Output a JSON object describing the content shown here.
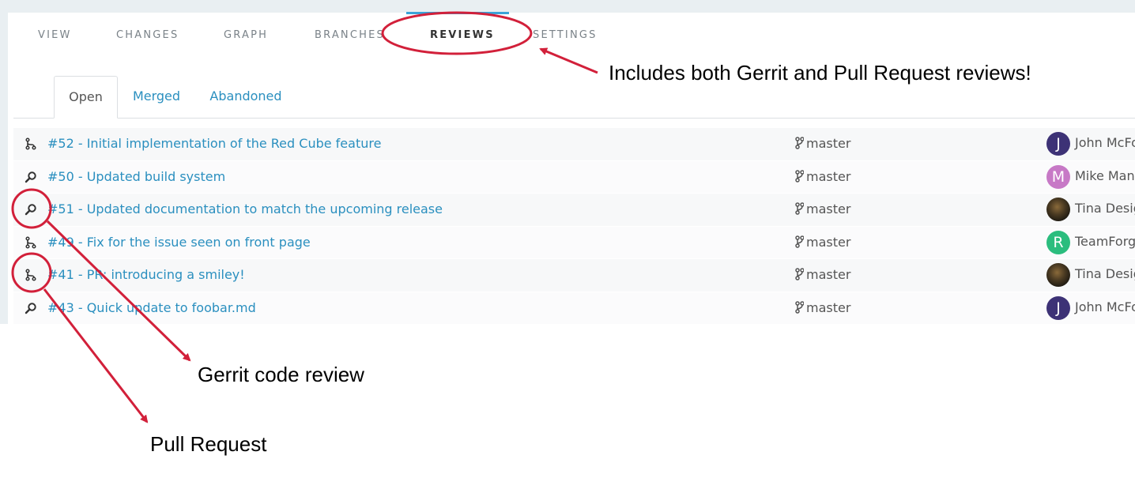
{
  "nav": {
    "tabs": [
      {
        "label": "VIEW"
      },
      {
        "label": "CHANGES"
      },
      {
        "label": "GRAPH"
      },
      {
        "label": "BRANCHES"
      },
      {
        "label": "REVIEWS"
      },
      {
        "label": "SETTINGS"
      }
    ],
    "active": "REVIEWS"
  },
  "sub_tabs": [
    {
      "label": "Open"
    },
    {
      "label": "Merged"
    },
    {
      "label": "Abandoned"
    }
  ],
  "reviews": [
    {
      "type": "pull-request",
      "title": "#52 - Initial implementation of the Red Cube feature",
      "branch": "master",
      "author": "John McFo",
      "avatar_letter": "J",
      "avatar_color": "#3d3276"
    },
    {
      "type": "gerrit",
      "title": "#50 - Updated build system",
      "branch": "master",
      "author": "Mike Mana",
      "avatar_letter": "M",
      "avatar_color": "#c779c6"
    },
    {
      "type": "gerrit",
      "title": "#51 - Updated documentation to match the upcoming release",
      "branch": "master",
      "author": "Tina Desig",
      "avatar_letter": "",
      "avatar_color": "#3b2f1c"
    },
    {
      "type": "pull-request",
      "title": "#49 - Fix for the issue seen on front page",
      "branch": "master",
      "author": "TeamForge",
      "avatar_letter": "R",
      "avatar_color": "#2bbd7e"
    },
    {
      "type": "pull-request",
      "title": "#41 - PR: introducing a smiley!",
      "branch": "master",
      "author": "Tina Desig",
      "avatar_letter": "",
      "avatar_color": "#3b2f1c"
    },
    {
      "type": "gerrit",
      "title": "#43 - Quick update to foobar.md",
      "branch": "master",
      "author": "John McFo",
      "avatar_letter": "J",
      "avatar_color": "#3d3276"
    }
  ],
  "annotations": {
    "reviews_note": "Includes both Gerrit and Pull Request reviews!",
    "gerrit_note": "Gerrit code review",
    "pr_note": "Pull Request"
  },
  "colors": {
    "annotation": "#d2203a",
    "link": "#2a8fbf",
    "active_bar": "#3aa3d8"
  }
}
